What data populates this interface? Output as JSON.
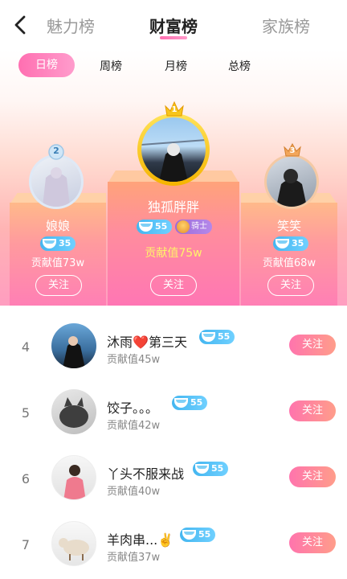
{
  "header": {
    "tabs": [
      {
        "label": "魅力榜",
        "active": false
      },
      {
        "label": "财富榜",
        "active": true
      },
      {
        "label": "家族榜",
        "active": false
      }
    ]
  },
  "periods": [
    {
      "label": "日榜",
      "active": true
    },
    {
      "label": "周榜",
      "active": false
    },
    {
      "label": "月榜",
      "active": false
    },
    {
      "label": "总榜",
      "active": false
    }
  ],
  "podium": {
    "first": {
      "rank": "1",
      "name": "独孤胖胖",
      "level": "55",
      "title_badge": "骑士",
      "contribution": "贡献值75w",
      "follow": "关注"
    },
    "second": {
      "rank": "2",
      "name": "娘娘",
      "level": "35",
      "contribution": "贡献值73w",
      "follow": "关注"
    },
    "third": {
      "rank": "3",
      "name": "笑笑",
      "level": "35",
      "contribution": "贡献值68w",
      "follow": "关注"
    }
  },
  "list": [
    {
      "rank": "4",
      "name_a": "沐雨",
      "name_heart": "❤️",
      "name_b": "第三天",
      "level": "55",
      "contribution": "贡献值45w",
      "follow": "关注"
    },
    {
      "rank": "5",
      "name": "饺子。。。",
      "level": "55",
      "contribution": "贡献值42w",
      "follow": "关注"
    },
    {
      "rank": "6",
      "name": "丫头不服来战",
      "level": "55",
      "contribution": "贡献值40w",
      "follow": "关注"
    },
    {
      "rank": "7",
      "name": "羊肉串...✌️",
      "level": "55",
      "contribution": "贡献值37w",
      "follow": "关注"
    }
  ],
  "colors": {
    "accent": "#ff6fb1",
    "badge_blue": "#44b6f0",
    "gold": "#f7c51c"
  }
}
